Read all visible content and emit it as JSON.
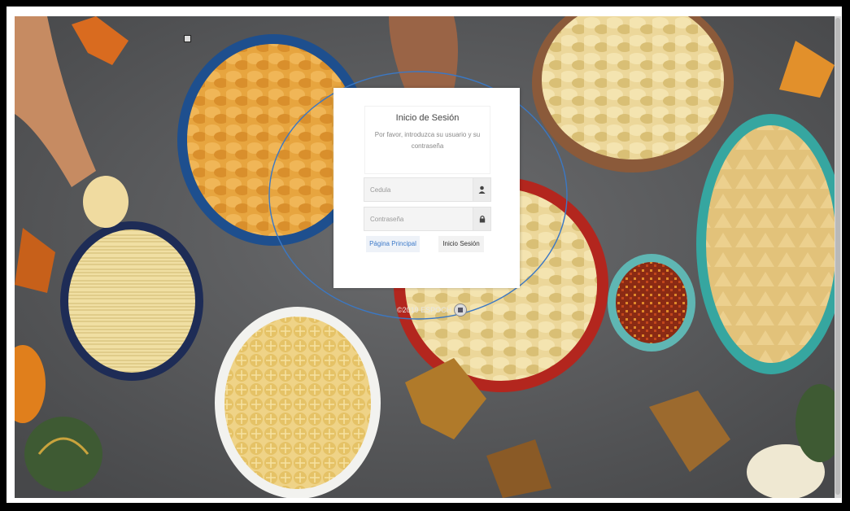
{
  "login": {
    "title": "Inicio de Sesión",
    "subtitle": "Por favor, introduzca su usuario y su contraseña",
    "username_placeholder": "Cedula",
    "password_placeholder": "Contraseña",
    "home_button": "Página Principal",
    "login_button": "Inicio Sesión"
  },
  "footer": {
    "text": "©2019 ESPOCH"
  },
  "icons": {
    "user": "user-icon",
    "lock": "lock-icon",
    "logo": "espoch-logo-icon"
  },
  "colors": {
    "link": "#3d7ac9",
    "highlight_ellipse": "#3b78c4"
  }
}
